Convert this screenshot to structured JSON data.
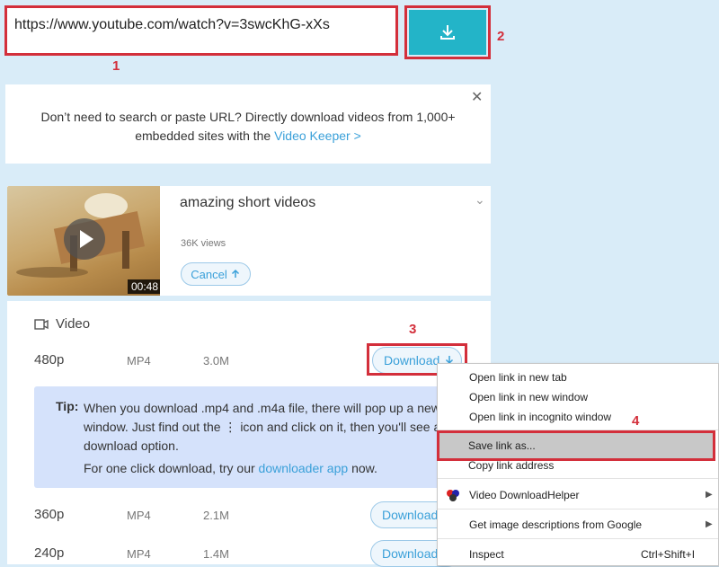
{
  "url_bar": {
    "value": "https://www.youtube.com/watch?v=3swcKhG-xXs",
    "download_icon": "download-icon"
  },
  "steps": {
    "s1": "1",
    "s2": "2",
    "s3": "3",
    "s4": "4"
  },
  "promo": {
    "text_before": "Don’t need to search or paste URL? Directly download videos from 1,000+ embedded sites with the",
    "link": "Video Keeper >",
    "close": "✕"
  },
  "video": {
    "title": "amazing short videos",
    "views": "36K views",
    "duration": "00:48",
    "cancel_label": "Cancel",
    "collapse": "⌄"
  },
  "formats": {
    "section_label": "Video",
    "rows": [
      {
        "quality": "480p",
        "format": "MP4",
        "size": "3.0M",
        "button": "Download"
      },
      {
        "quality": "360p",
        "format": "MP4",
        "size": "2.1M",
        "button": "Download"
      },
      {
        "quality": "240p",
        "format": "MP4",
        "size": "1.4M",
        "button": "Download"
      }
    ]
  },
  "tip": {
    "label": "Tip:",
    "text": "When you download .mp4 and .m4a file, there will pop up a new window. Just find out the ⋮ icon and click on it, then you'll see a download option.",
    "line2_before": "For one click download, try our",
    "line2_link": "downloader app",
    "line2_after": "now."
  },
  "context_menu": {
    "items": [
      "Open link in new tab",
      "Open link in new window",
      "Open link in incognito window",
      "Save link as...",
      "Copy link address",
      "Video DownloadHelper",
      "Get image descriptions from Google",
      "Inspect"
    ],
    "inspect_shortcut": "Ctrl+Shift+I"
  },
  "colors": {
    "accent": "#23b4c8",
    "highlight": "#d32f3b",
    "link": "#3aa0d9"
  }
}
